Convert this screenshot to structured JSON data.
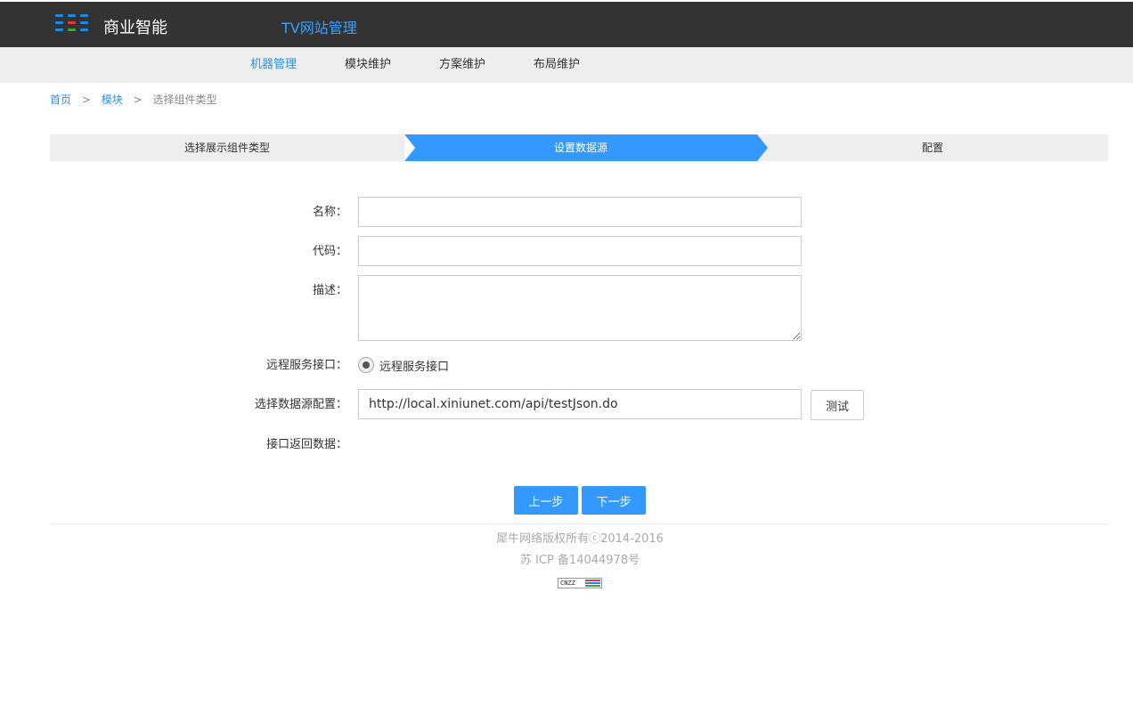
{
  "header": {
    "brand": "商业智能",
    "app_title": "TV网站管理",
    "logo_colors": [
      "#1e88e5",
      "#e53935",
      "#43a047"
    ]
  },
  "subnav": {
    "items": [
      {
        "label": "机器管理",
        "active": true
      },
      {
        "label": "模块维护",
        "active": false
      },
      {
        "label": "方案维护",
        "active": false
      },
      {
        "label": "布局维护",
        "active": false
      }
    ]
  },
  "breadcrumb": {
    "home": "首页",
    "module": "模块",
    "current": "选择组件类型",
    "separator": ">"
  },
  "steps": [
    {
      "label": "选择展示组件类型",
      "active": false
    },
    {
      "label": "设置数据源",
      "active": true
    },
    {
      "label": "配置",
      "active": false
    }
  ],
  "form": {
    "name_label": "名称：",
    "name_value": "",
    "code_label": "代码：",
    "code_value": "",
    "desc_label": "描述：",
    "desc_value": "",
    "remote_label": "远程服务接口：",
    "remote_option": "远程服务接口",
    "datasource_label": "选择数据源配置：",
    "datasource_value": "http://local.xiniunet.com/api/testJson.do",
    "test_button": "测试",
    "response_label": "接口返回数据："
  },
  "actions": {
    "prev": "上一步",
    "next": "下一步"
  },
  "footer": {
    "copyright": "犀牛网络版权所有ⓒ2014-2016",
    "icp": "苏 ICP 备14044978号",
    "badge": "CNZZ"
  },
  "colors": {
    "accent": "#3399ff",
    "topbar": "#333333",
    "subnav": "#eeeeee"
  }
}
